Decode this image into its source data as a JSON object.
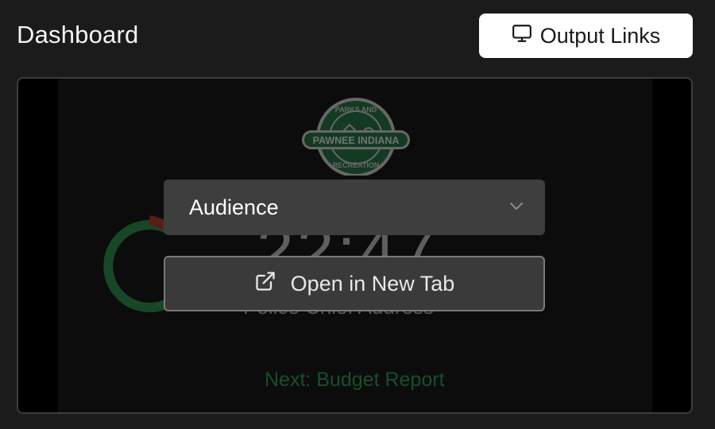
{
  "header": {
    "title": "Dashboard",
    "output_links_label": "Output Links",
    "output_links_icon": "monitor-icon"
  },
  "preview": {
    "logo": {
      "top_text": "PARKS AND",
      "middle_text": "PAWNEE INDIANA",
      "bottom_text": "RECREATION"
    },
    "countdown": "22:47",
    "current_item": "Police Chief Address",
    "next_item": "Next: Budget Report",
    "accent_green": "#1f7a45",
    "accent_red": "#c0392b"
  },
  "overlay": {
    "audience_select": {
      "selected": "Audience",
      "icon": "chevron-down-icon"
    },
    "open_tab": {
      "label": "Open in New Tab",
      "icon": "external-link-icon"
    }
  }
}
